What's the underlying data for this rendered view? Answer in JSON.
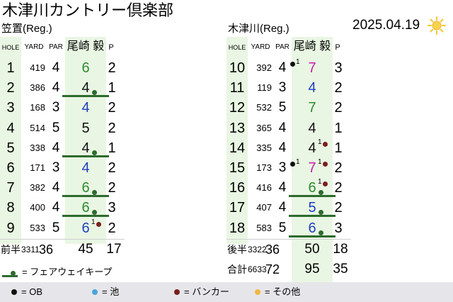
{
  "title": "木津川カントリー倶楽部",
  "date": "2025.04.19",
  "weather_icon": "sun-icon",
  "colors": {
    "band": "#e9f6e3",
    "fairway": "#2e6b2e",
    "ob": "#111111",
    "pond": "#4aa3df",
    "bunker": "#7a1e1e",
    "other": "#f2b640"
  },
  "headers": {
    "hole": "HOLE",
    "yard": "YARD",
    "par": "PAR",
    "player": "尾崎 毅",
    "putt": "P"
  },
  "front": {
    "course": "笠置(Reg.)",
    "holes": [
      {
        "no": "1",
        "yard": "419",
        "par": "4",
        "score": "6",
        "putt": "2",
        "fw": false,
        "color": "#2e8b2e",
        "marks": []
      },
      {
        "no": "2",
        "yard": "386",
        "par": "4",
        "score": "4",
        "putt": "1",
        "fw": true,
        "color": "#111111",
        "marks": []
      },
      {
        "no": "3",
        "yard": "168",
        "par": "3",
        "score": "4",
        "putt": "2",
        "fw": false,
        "color": "#1f3fbf",
        "marks": []
      },
      {
        "no": "4",
        "yard": "514",
        "par": "5",
        "score": "5",
        "putt": "2",
        "fw": false,
        "color": "#111111",
        "marks": []
      },
      {
        "no": "5",
        "yard": "338",
        "par": "4",
        "score": "4",
        "putt": "1",
        "fw": true,
        "color": "#111111",
        "marks": []
      },
      {
        "no": "6",
        "yard": "171",
        "par": "3",
        "score": "4",
        "putt": "2",
        "fw": false,
        "color": "#1f3fbf",
        "marks": []
      },
      {
        "no": "7",
        "yard": "382",
        "par": "4",
        "score": "6",
        "putt": "2",
        "fw": true,
        "color": "#2e8b2e",
        "marks": []
      },
      {
        "no": "8",
        "yard": "400",
        "par": "4",
        "score": "6",
        "putt": "3",
        "fw": true,
        "color": "#2e8b2e",
        "marks": []
      },
      {
        "no": "9",
        "yard": "533",
        "par": "5",
        "score": "6",
        "putt": "2",
        "fw": false,
        "color": "#1f3fbf",
        "marks": [
          {
            "type": "bunker",
            "count": "1",
            "side": "right"
          }
        ]
      }
    ],
    "total": {
      "label": "前半",
      "yard": "3311",
      "par": "36",
      "score": "45",
      "putt": "17"
    }
  },
  "back": {
    "course": "木津川(Reg.)",
    "holes": [
      {
        "no": "10",
        "yard": "392",
        "par": "4",
        "score": "7",
        "putt": "3",
        "fw": false,
        "color": "#c71fa8",
        "marks": [
          {
            "type": "ob",
            "count": "1",
            "side": "left"
          }
        ]
      },
      {
        "no": "11",
        "yard": "119",
        "par": "3",
        "score": "4",
        "putt": "2",
        "fw": false,
        "color": "#1f3fbf",
        "marks": []
      },
      {
        "no": "12",
        "yard": "532",
        "par": "5",
        "score": "7",
        "putt": "2",
        "fw": false,
        "color": "#2e8b2e",
        "marks": []
      },
      {
        "no": "13",
        "yard": "365",
        "par": "4",
        "score": "4",
        "putt": "1",
        "fw": false,
        "color": "#111111",
        "marks": []
      },
      {
        "no": "14",
        "yard": "335",
        "par": "4",
        "score": "4",
        "putt": "1",
        "fw": false,
        "color": "#111111",
        "marks": [
          {
            "type": "bunker",
            "count": "1",
            "side": "right"
          }
        ]
      },
      {
        "no": "15",
        "yard": "173",
        "par": "3",
        "score": "7",
        "putt": "2",
        "fw": false,
        "color": "#c71fa8",
        "marks": [
          {
            "type": "ob",
            "count": "1",
            "side": "left"
          },
          {
            "type": "bunker",
            "count": "1",
            "side": "right"
          }
        ]
      },
      {
        "no": "16",
        "yard": "416",
        "par": "4",
        "score": "6",
        "putt": "2",
        "fw": true,
        "color": "#2e8b2e",
        "marks": [
          {
            "type": "bunker",
            "count": "1",
            "side": "right"
          }
        ]
      },
      {
        "no": "17",
        "yard": "407",
        "par": "4",
        "score": "5",
        "putt": "2",
        "fw": true,
        "color": "#1f3fbf",
        "marks": []
      },
      {
        "no": "18",
        "yard": "583",
        "par": "5",
        "score": "6",
        "putt": "3",
        "fw": true,
        "color": "#1f3fbf",
        "marks": []
      }
    ],
    "total": {
      "label": "後半",
      "yard": "3322",
      "par": "36",
      "score": "50",
      "putt": "18"
    }
  },
  "grand_total": {
    "label": "合計",
    "yard": "6633",
    "par": "72",
    "score": "95",
    "putt": "35"
  },
  "legend_fairway": "= フェアウェイキープ",
  "footer": [
    {
      "key": "ob",
      "label": "= OB"
    },
    {
      "key": "pond",
      "label": "= 池"
    },
    {
      "key": "bunker",
      "label": "= バンカー"
    },
    {
      "key": "other",
      "label": "= その他"
    }
  ]
}
